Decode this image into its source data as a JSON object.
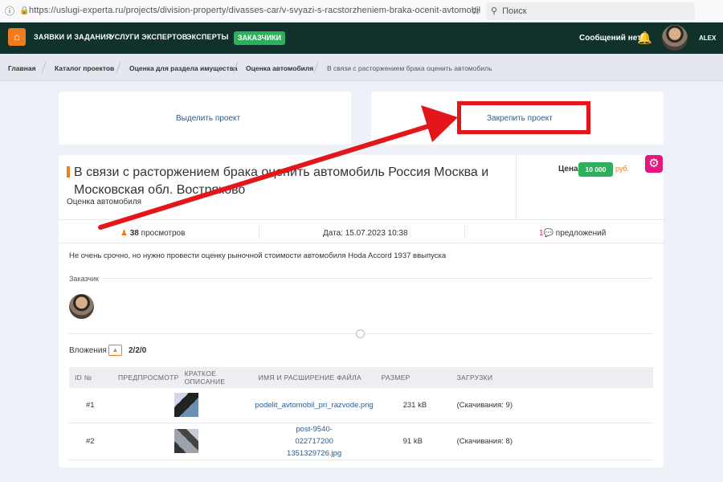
{
  "browser": {
    "url": "https://uslugi-experta.ru/projects/division-property/divasses-car/v-svyazi-s-racstorzheniem-braka-ocenit-avtomobil",
    "search_placeholder": "Поиск"
  },
  "nav": {
    "items": [
      "ЗАЯВКИ И ЗАДАНИЯ",
      "УСЛУГИ ЭКСПЕРТОВ",
      "ЭКСПЕРТЫ"
    ],
    "active": "ЗАКАЗЧИКИ",
    "messages": "Сообщений нет",
    "user": "ALEX"
  },
  "breadcrumbs": [
    "Главная",
    "Каталог проектов",
    "Оценка для раздела имущества",
    "Оценка автомобиля",
    "В связи с расторжением брака оценить автомобиль"
  ],
  "actions": {
    "highlight": "Выделить проект",
    "pin": "Закрепить проект"
  },
  "project": {
    "title": "В связи с расторжением брака оценить автомобиль Россия Москва и Московская обл. Востряково",
    "category": "Оценка автомобиля",
    "price_label": "Цена:",
    "price": "10 000",
    "currency": "руб.",
    "views_count": "38",
    "views_label": "просмотров",
    "date": "Дата: 15.07.2023 10:38",
    "offers_count": "1",
    "offers_label": "предложений",
    "description": "Не очень срочно, но нужно провести оценку рыночной стоимости автомобиля Hoda Accord 1937 ввыпуска",
    "customer_label": "Заказчик",
    "attachments_label": "Вложения",
    "attachments_count": "2/2/0"
  },
  "files_table": {
    "headers": [
      "ID №",
      "ПРЕДПРОСМОТР",
      "КРАТКОЕ ОПИСАНИЕ",
      "ИМЯ И РАСШИРЕНИЕ ФАЙЛА",
      "РАЗМЕР",
      "ЗАГРУЗКИ"
    ],
    "rows": [
      {
        "id": "#1",
        "name": "podelit_avtomobil_pri_razvode.png",
        "size": "231 kB",
        "downloads": "(Скачивания: 9)"
      },
      {
        "id": "#2",
        "name": "post-9540-022717200 1351329726.jpg",
        "size": "91 kB",
        "downloads": "(Скачивания: 8)"
      }
    ]
  },
  "annotation_color": "#e3161c"
}
